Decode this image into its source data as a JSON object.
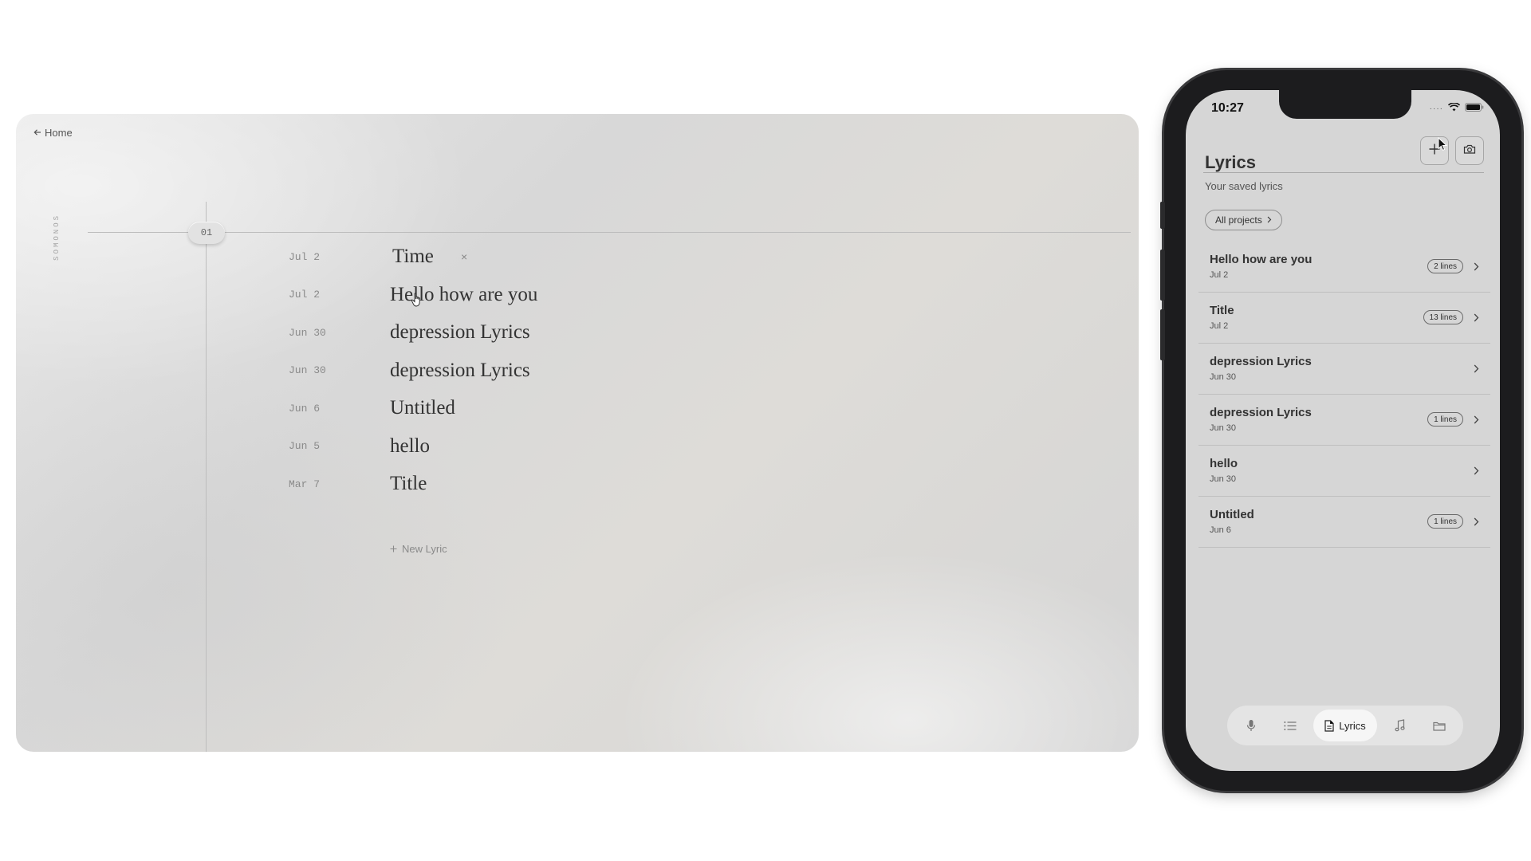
{
  "desktop": {
    "back_label": "Home",
    "brand": "SOMONOS",
    "section_index": "01",
    "lyrics": [
      {
        "date": "Jul 2",
        "title": "Time",
        "editing": true
      },
      {
        "date": "Jul 2",
        "title": "Hello how are you"
      },
      {
        "date": "Jun 30",
        "title": "depression Lyrics"
      },
      {
        "date": "Jun 30",
        "title": "depression Lyrics"
      },
      {
        "date": "Jun 6",
        "title": "Untitled"
      },
      {
        "date": "Jun 5",
        "title": "hello"
      },
      {
        "date": "Mar 7",
        "title": "Title"
      }
    ],
    "remove_glyph": "×",
    "new_lyric_label": "New Lyric"
  },
  "phone": {
    "status_time": "10:27",
    "title": "Lyrics",
    "subtitle": "Your saved lyrics",
    "filter_chip": "All projects",
    "items": [
      {
        "title": "Hello how are you",
        "date": "Jul 2",
        "badge": "2 lines"
      },
      {
        "title": "Title",
        "date": "Jul 2",
        "badge": "13 lines"
      },
      {
        "title": "depression Lyrics",
        "date": "Jun 30",
        "badge": ""
      },
      {
        "title": "depression Lyrics",
        "date": "Jun 30",
        "badge": "1 lines"
      },
      {
        "title": "hello",
        "date": "Jun 30",
        "badge": ""
      },
      {
        "title": "Untitled",
        "date": "Jun 6",
        "badge": "1 lines"
      }
    ],
    "tabs": [
      {
        "icon": "microphone-icon",
        "label": ""
      },
      {
        "icon": "list-icon",
        "label": ""
      },
      {
        "icon": "document-icon",
        "label": "Lyrics",
        "active": true
      },
      {
        "icon": "music-note-icon",
        "label": ""
      },
      {
        "icon": "folder-icon",
        "label": ""
      }
    ]
  }
}
